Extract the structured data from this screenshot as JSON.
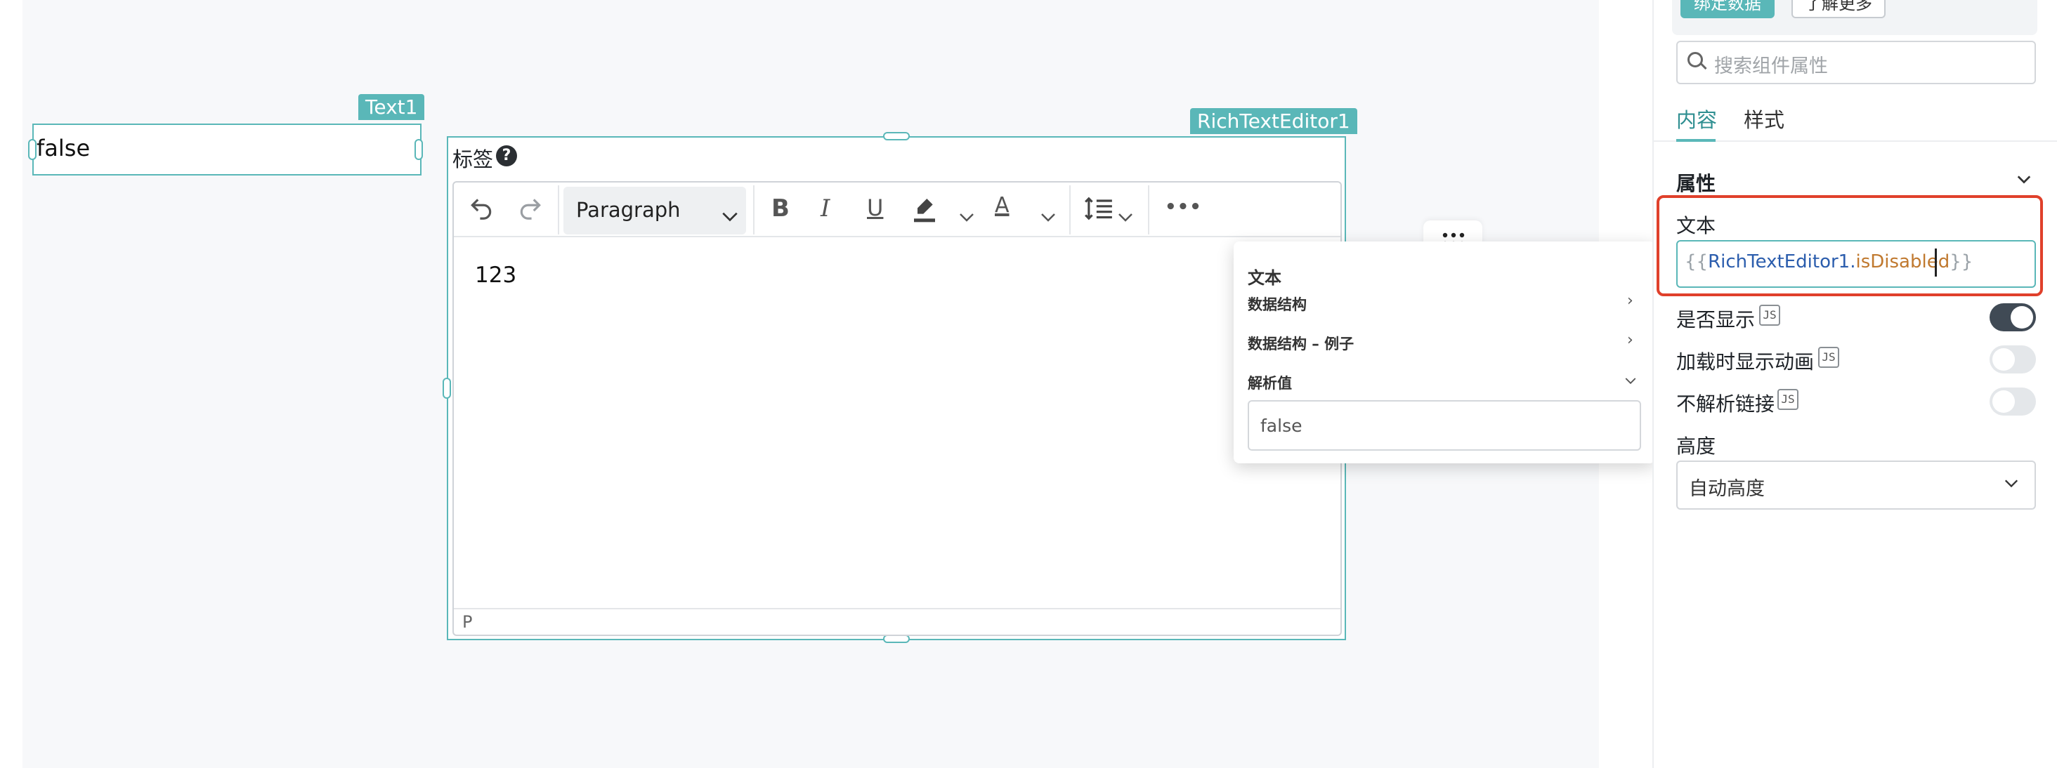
{
  "canvas": {
    "text1": {
      "tag": "Text1",
      "value": "false"
    },
    "rich_text_editor": {
      "tag": "RichTextEditor1",
      "label": "标签",
      "help_icon": "question-circle-icon",
      "toolbar": {
        "undo_icon": "undo-icon",
        "redo_icon": "redo-icon",
        "block_format": "Paragraph",
        "bold": "B",
        "italic": "I",
        "underline": "U",
        "text_color": "A",
        "more": "•••"
      },
      "content": "123",
      "status_path": "P"
    }
  },
  "popover": {
    "title": "文本",
    "items": [
      {
        "label": "数据结构"
      },
      {
        "label": "数据结构 – 例子"
      },
      {
        "label": "解析值"
      }
    ],
    "evaluated_value": "false"
  },
  "panel": {
    "top_buttons": {
      "bind": "绑定数据",
      "learn": "了解更多"
    },
    "search": {
      "placeholder": "搜索组件属性"
    },
    "tabs": [
      {
        "label": "内容"
      },
      {
        "label": "样式"
      }
    ],
    "section_title": "属性",
    "text_field": {
      "label": "文本",
      "open": "{{",
      "object": "RichTextEditor1",
      "dot": ".",
      "property": "isDisabled",
      "close": "}}"
    },
    "toggles": [
      {
        "label": "是否显示",
        "js": "JS",
        "on": true
      },
      {
        "label": "加载时显示动画",
        "js": "JS",
        "on": false
      },
      {
        "label": "不解析链接",
        "js": "JS",
        "on": false
      }
    ],
    "height": {
      "label": "高度",
      "value": "自动高度"
    }
  },
  "colors": {
    "accent": "#5ab7b8",
    "highlight": "#e0402b",
    "toggle_on": "#404a55"
  }
}
